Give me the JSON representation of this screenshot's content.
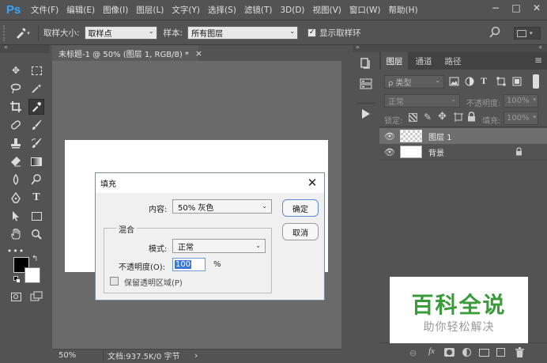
{
  "menubar": {
    "logo": "Ps",
    "items": [
      "文件(F)",
      "编辑(E)",
      "图像(I)",
      "图层(L)",
      "文字(Y)",
      "选择(S)",
      "滤镜(T)",
      "3D(D)",
      "视图(V)",
      "窗口(W)",
      "帮助(H)"
    ],
    "window_controls": [
      "−",
      "□",
      "✕"
    ]
  },
  "options": {
    "sample_size_label": "取样大小:",
    "sample_size_value": "取样点",
    "sample_label": "样本:",
    "sample_value": "所有图层",
    "show_ring_label": "显示取样环",
    "show_ring_checked": "✓"
  },
  "document": {
    "tab_title": "未标题-1 @ 50% (图层 1, RGB/8) *",
    "tab_close": "×",
    "zoom": "50%",
    "doc_info": "文档:937.5K/0 字节",
    "status_arrow": "›"
  },
  "layers_panel": {
    "tabs": [
      "图层",
      "通道",
      "路径"
    ],
    "filter_label": "ρ 类型",
    "blend_mode": "正常",
    "opacity_label": "不透明度:",
    "opacity_value": "100%",
    "lock_label": "锁定:",
    "fill_label": "填充:",
    "fill_value": "100%",
    "layers": [
      {
        "name": "图层 1",
        "selected": true,
        "transparent": true
      },
      {
        "name": "背景",
        "selected": false,
        "transparent": false
      }
    ]
  },
  "dialog": {
    "title": "填充",
    "content_label": "内容:",
    "content_value": "50% 灰色",
    "blend_group_label": "混合",
    "mode_label": "模式:",
    "mode_value": "正常",
    "opacity_label": "不透明度(O):",
    "opacity_value": "100",
    "opacity_unit": "%",
    "preserve_label": "保留透明区域(P)",
    "ok_label": "确定",
    "cancel_label": "取消"
  },
  "watermark": {
    "title": "百科全说",
    "subtitle": "助你轻松解决"
  },
  "colors": {
    "ui_bg": "#535353",
    "canvas_bg": "#6a6a6a",
    "accent": "#31a8ff",
    "watermark_green": "#3a9b3a"
  }
}
